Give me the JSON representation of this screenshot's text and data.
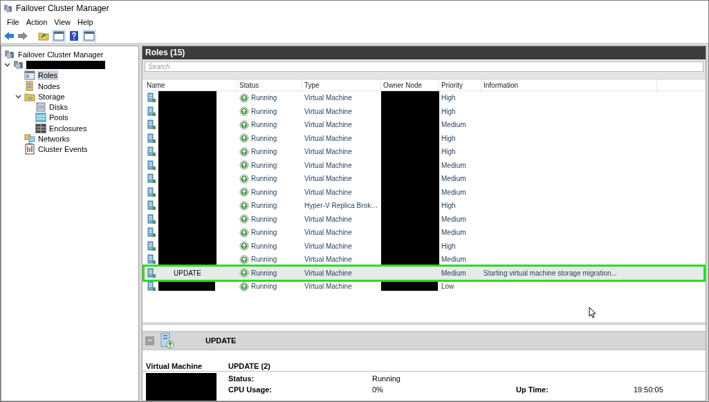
{
  "window": {
    "title": "Failover Cluster Manager"
  },
  "menu": [
    "File",
    "Action",
    "View",
    "Help"
  ],
  "tree": [
    {
      "label": "Failover Cluster Manager",
      "children": [
        {
          "redacted": true,
          "expanded": true,
          "children": [
            {
              "label": "Roles",
              "selected": true
            },
            {
              "label": "Nodes",
              "selected": false
            },
            {
              "label": "Storage",
              "expanded": true,
              "selected": false,
              "children": [
                {
                  "label": "Disks",
                  "selected": false
                },
                {
                  "label": "Pools",
                  "selected": false
                },
                {
                  "label": "Enclosures",
                  "selected": false
                }
              ]
            },
            {
              "label": "Networks",
              "selected": false
            },
            {
              "label": "Cluster Events",
              "selected": false
            }
          ]
        }
      ]
    }
  ],
  "roles": {
    "title": "Roles (15)",
    "search": {
      "placeholder": "Search"
    },
    "columns": [
      "Name",
      "Status",
      "Type",
      "Owner Node",
      "Priority",
      "Information"
    ],
    "rows": [
      {
        "name_redacted": true,
        "status": "Running",
        "type": "Virtual Machine",
        "owner_redacted": true,
        "priority": "High",
        "selected": false
      },
      {
        "name_redacted": true,
        "status": "Running",
        "type": "Virtual Machine",
        "owner_redacted": true,
        "priority": "High",
        "selected": false
      },
      {
        "name_redacted": true,
        "status": "Running",
        "type": "Virtual Machine",
        "owner_redacted": true,
        "priority": "Medium",
        "selected": false
      },
      {
        "name_redacted": true,
        "status": "Running",
        "type": "Virtual Machine",
        "owner_redacted": true,
        "priority": "High",
        "selected": false
      },
      {
        "name_redacted": true,
        "status": "Running",
        "type": "Virtual Machine",
        "owner_redacted": true,
        "priority": "High",
        "selected": false
      },
      {
        "name_redacted": true,
        "status": "Running",
        "type": "Virtual Machine",
        "owner_redacted": true,
        "priority": "Medium",
        "selected": false
      },
      {
        "name_redacted": true,
        "status": "Running",
        "type": "Virtual Machine",
        "owner_redacted": true,
        "priority": "Medium",
        "selected": false
      },
      {
        "name_redacted": true,
        "status": "Running",
        "type": "Virtual Machine",
        "owner_redacted": true,
        "priority": "Medium",
        "selected": false
      },
      {
        "name_redacted": true,
        "status": "Running",
        "type": "Hyper-V Replica Brok…",
        "owner_redacted": true,
        "priority": "High",
        "selected": false
      },
      {
        "name_redacted": true,
        "status": "Running",
        "type": "Virtual Machine",
        "owner_redacted": true,
        "priority": "Medium",
        "selected": false
      },
      {
        "name_redacted": true,
        "status": "Running",
        "type": "Virtual Machine",
        "owner_redacted": true,
        "priority": "Medium",
        "selected": false
      },
      {
        "name_redacted": true,
        "status": "Running",
        "type": "Virtual Machine",
        "owner_redacted": true,
        "priority": "High",
        "selected": false
      },
      {
        "name_redacted": true,
        "status": "Running",
        "type": "Virtual Machine",
        "owner_redacted": true,
        "priority": "Medium",
        "selected": false
      },
      {
        "name": "UPDATE",
        "status": "Running",
        "type": "Virtual Machine",
        "owner_redacted": false,
        "priority": "Medium",
        "information": "Starting virtual machine storage migration...",
        "selected": true
      },
      {
        "name_redacted": true,
        "status": "Running",
        "type": "Virtual Machine",
        "owner_redacted": true,
        "priority": "Low",
        "selected": false
      }
    ]
  },
  "details": {
    "title": "UPDATE",
    "section_label": "Virtual Machine",
    "section_title": "UPDATE (2)",
    "fields": [
      {
        "label": "Status:",
        "value": "Running"
      },
      {
        "label": "CPU Usage:",
        "value": "0%",
        "extra_label": "Up Time:",
        "extra_value": "19:50:05"
      }
    ]
  }
}
